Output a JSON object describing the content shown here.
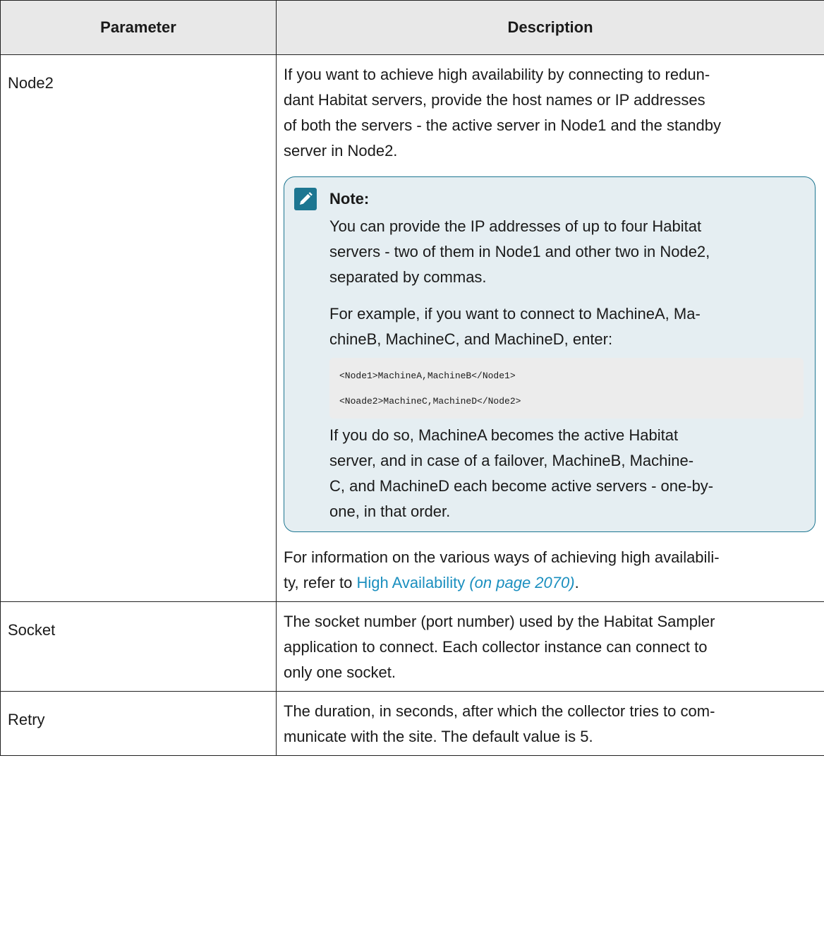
{
  "table": {
    "headers": {
      "parameter": "Parameter",
      "description": "Description"
    },
    "rows": [
      {
        "parameter": "Node2",
        "description_lines": [
          "If you want to achieve high availability by connecting to redun-",
          "dant Habitat servers, provide the host names or IP addresses",
          "of both the servers - the active server in Node1 and the standby",
          "server in Node2."
        ],
        "note": {
          "title": "Note:",
          "icon": "pencil-icon",
          "para1_lines": [
            "You can provide the IP addresses of up to four Habitat",
            "servers - two of them in Node1 and other two in Node2,",
            "separated by commas."
          ],
          "para2_lines": [
            "For example, if you want to connect to MachineA, Ma-",
            "chineB, MachineC, and MachineD, enter:"
          ],
          "code_lines": [
            "<Node1>MachineA,MachineB</Node1>",
            "<Noade2>MachineC,MachineD</Node2>"
          ],
          "para3_lines": [
            "If you do so, MachineA becomes the active Habitat",
            "server, and in case of a failover, MachineB, Machine-",
            "C, and MachineD each become active servers - one-by-",
            "one, in that order."
          ]
        },
        "after_note_line1": "For information on the various ways of achieving high availabili-",
        "after_note_prefix": "ty, refer to ",
        "link_text": "High Availability",
        "page_ref": "(on page 2070)",
        "after_note_suffix": "."
      },
      {
        "parameter": "Socket",
        "description_lines": [
          "The socket number (port number) used by the Habitat Sampler",
          "application to connect. Each collector instance can connect to",
          "only one socket."
        ]
      },
      {
        "parameter": "Retry",
        "description_lines": [
          "The duration, in seconds, after which the collector tries to com-",
          "municate with the site. The default value is 5."
        ]
      }
    ]
  },
  "colors": {
    "note_border": "#1d7691",
    "note_background": "#e5eef2",
    "link": "#1b8fbf",
    "header_background": "#e8e8e8"
  }
}
